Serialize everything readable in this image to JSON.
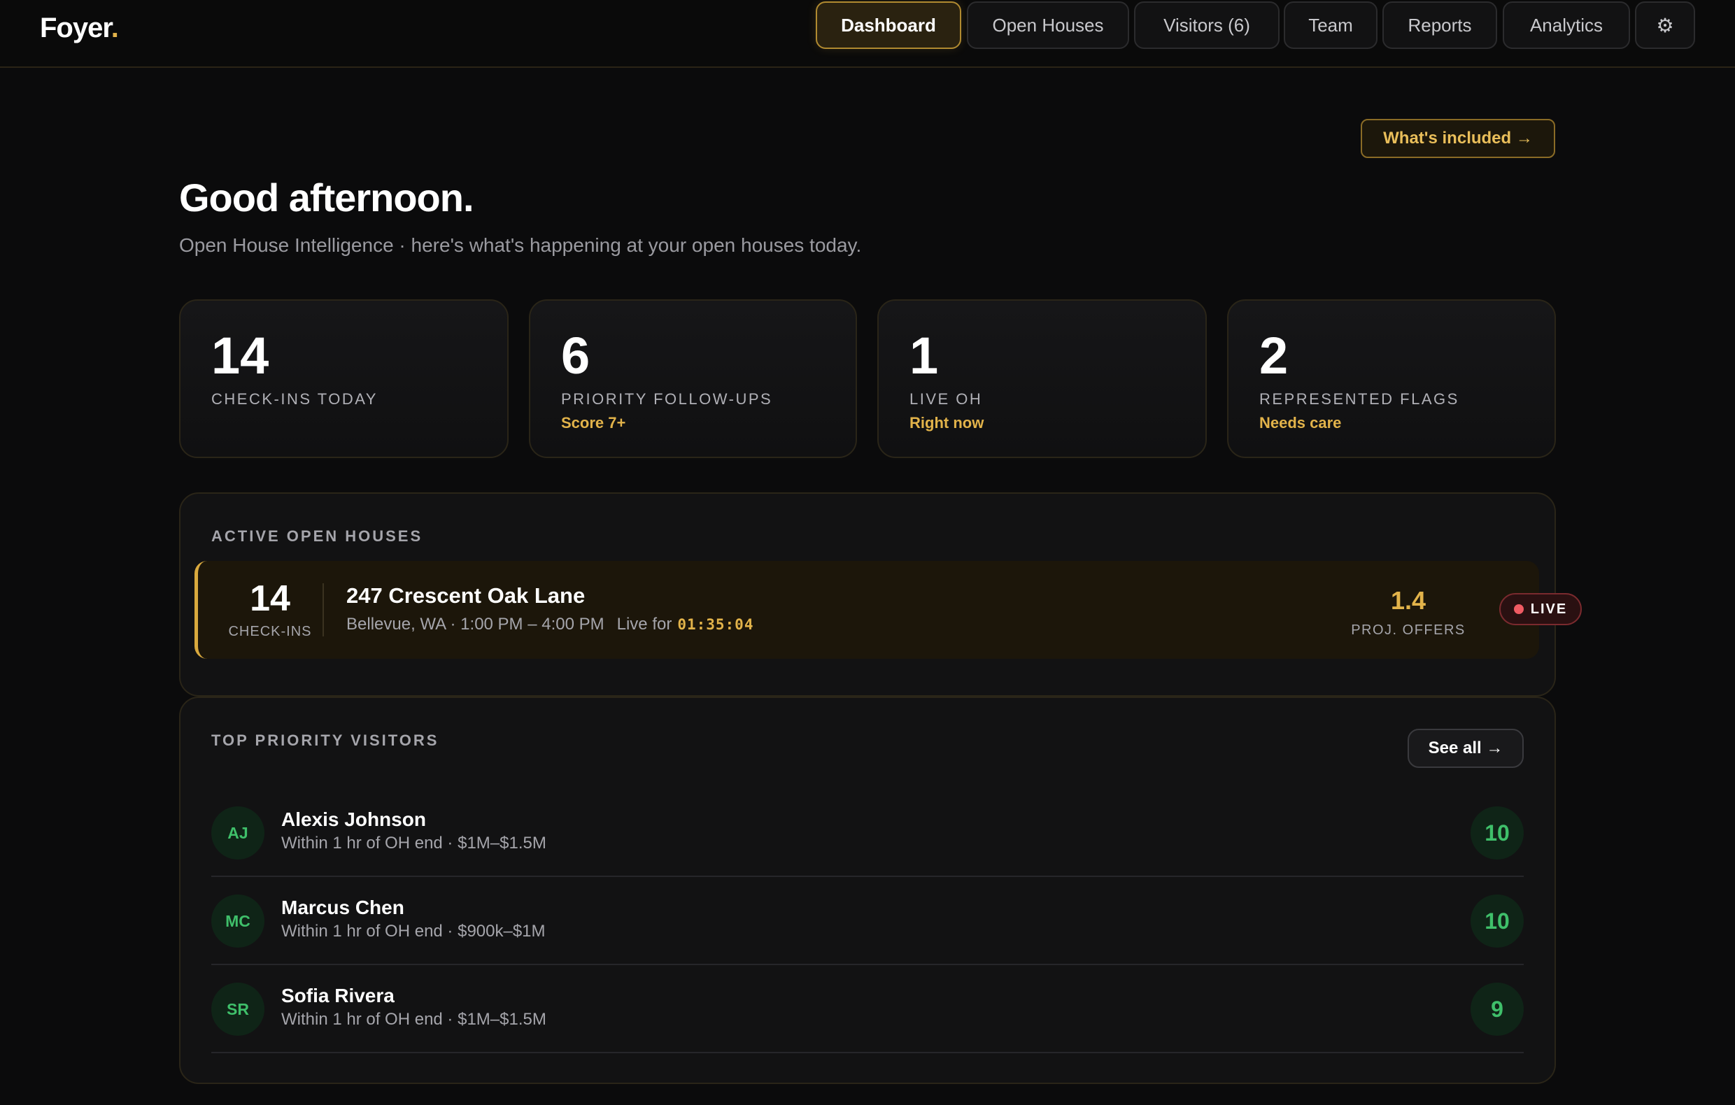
{
  "app": {
    "logo_text": "Foyer",
    "logo_dot": "."
  },
  "nav": {
    "items": [
      {
        "label": "Dashboard",
        "active": true
      },
      {
        "label": "Open Houses",
        "active": false
      },
      {
        "label": "Visitors (6)",
        "active": false
      },
      {
        "label": "Team",
        "active": false
      },
      {
        "label": "Reports",
        "active": false
      },
      {
        "label": "Analytics",
        "active": false
      }
    ],
    "settings_icon": "⚙"
  },
  "hero": {
    "whats_included": "What's included →",
    "greeting": "Good afternoon.",
    "subtitle": "Open House Intelligence · here's what's happening at your open houses today."
  },
  "stats": [
    {
      "value": "14",
      "label": "CHECK-INS TODAY",
      "sub": ""
    },
    {
      "value": "6",
      "label": "PRIORITY FOLLOW-UPS",
      "sub": "Score 7+"
    },
    {
      "value": "1",
      "label": "LIVE OH",
      "sub": "Right now"
    },
    {
      "value": "2",
      "label": "REPRESENTED FLAGS",
      "sub": "Needs care"
    }
  ],
  "active_open_houses": {
    "title": "ACTIVE OPEN HOUSES",
    "items": [
      {
        "checkins": "14",
        "checkins_label": "CHECK-INS",
        "address": "247 Crescent Oak Lane",
        "meta": "Bellevue, WA · 1:00 PM – 4:00 PM",
        "live_for_label": "Live for",
        "timer": "01:35:04",
        "proj_offers": "1.4",
        "proj_offers_label": "PROJ. OFFERS",
        "status": "LIVE"
      }
    ]
  },
  "top_visitors": {
    "title": "TOP PRIORITY VISITORS",
    "see_all": "See all →",
    "items": [
      {
        "initials": "AJ",
        "name": "Alexis Johnson",
        "meta": "Within 1 hr of OH end · $1M–$1.5M",
        "score": "10"
      },
      {
        "initials": "MC",
        "name": "Marcus Chen",
        "meta": "Within 1 hr of OH end · $900k–$1M",
        "score": "10"
      },
      {
        "initials": "SR",
        "name": "Sofia Rivera",
        "meta": "Within 1 hr of OH end · $1M–$1.5M",
        "score": "9"
      }
    ]
  },
  "colors": {
    "accent": "#e2b34a",
    "live": "#ef5b63",
    "score": "#3fbf6a",
    "background": "#0b0b0c"
  }
}
